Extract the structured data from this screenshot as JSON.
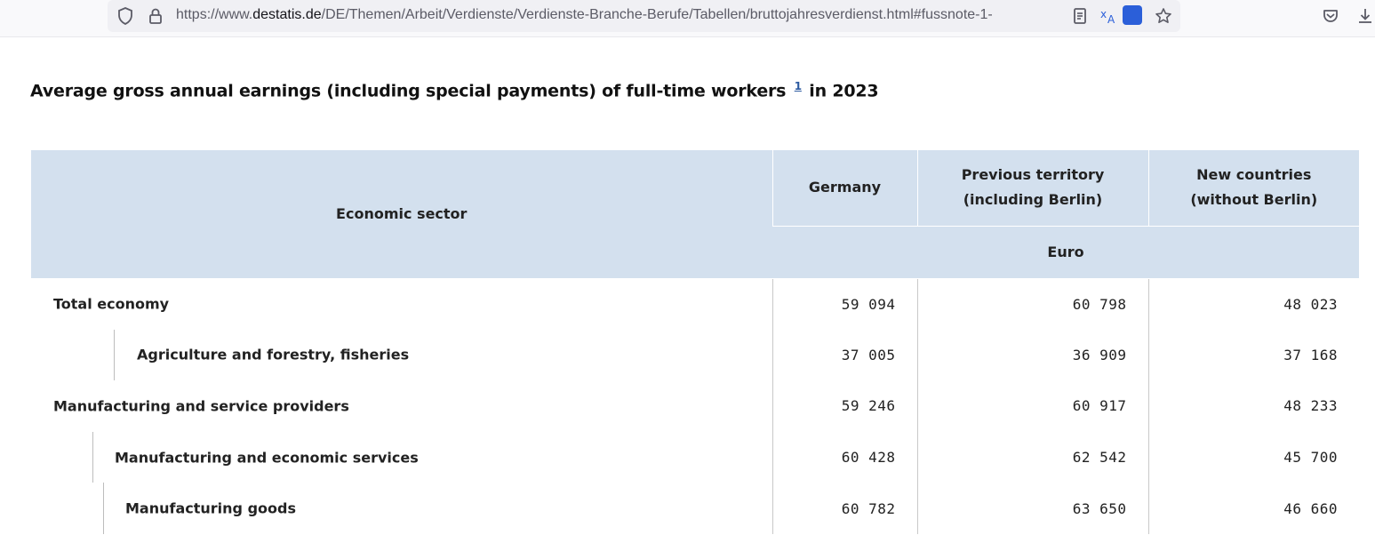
{
  "browser": {
    "url_prefix": "https://www.",
    "url_domain": "destatis.de",
    "url_path": "/DE/Themen/Arbeit/Verdienste/Verdienste-Branche-Berufe/Tabellen/bruttojahresverdienst.html#fussnote-1-"
  },
  "page": {
    "title_before": "Average gross annual earnings (including special payments) of full-time workers",
    "title_footnote": "1",
    "title_after": "in 2023"
  },
  "table": {
    "headers": {
      "sector": "Economic sector",
      "germany": "Germany",
      "previous_territory_line1": "Previous territory",
      "previous_territory_line2": "(including Berlin)",
      "new_countries_line1": "New countries",
      "new_countries_line2": "(without Berlin)",
      "unit": "Euro"
    },
    "rows": [
      {
        "label": "Total economy",
        "germany": "59 094",
        "previous": "60 798",
        "new": "48 023"
      },
      {
        "label": "Agriculture and forestry, fisheries",
        "germany": "37 005",
        "previous": "36 909",
        "new": "37 168"
      },
      {
        "label": "Manufacturing and service providers",
        "germany": "59 246",
        "previous": "60 917",
        "new": "48 233"
      },
      {
        "label": "Manufacturing and economic services",
        "germany": "60 428",
        "previous": "62 542",
        "new": "45 700"
      },
      {
        "label": "Manufacturing goods",
        "germany": "60 782",
        "previous": "63 650",
        "new": "46 660"
      }
    ]
  }
}
